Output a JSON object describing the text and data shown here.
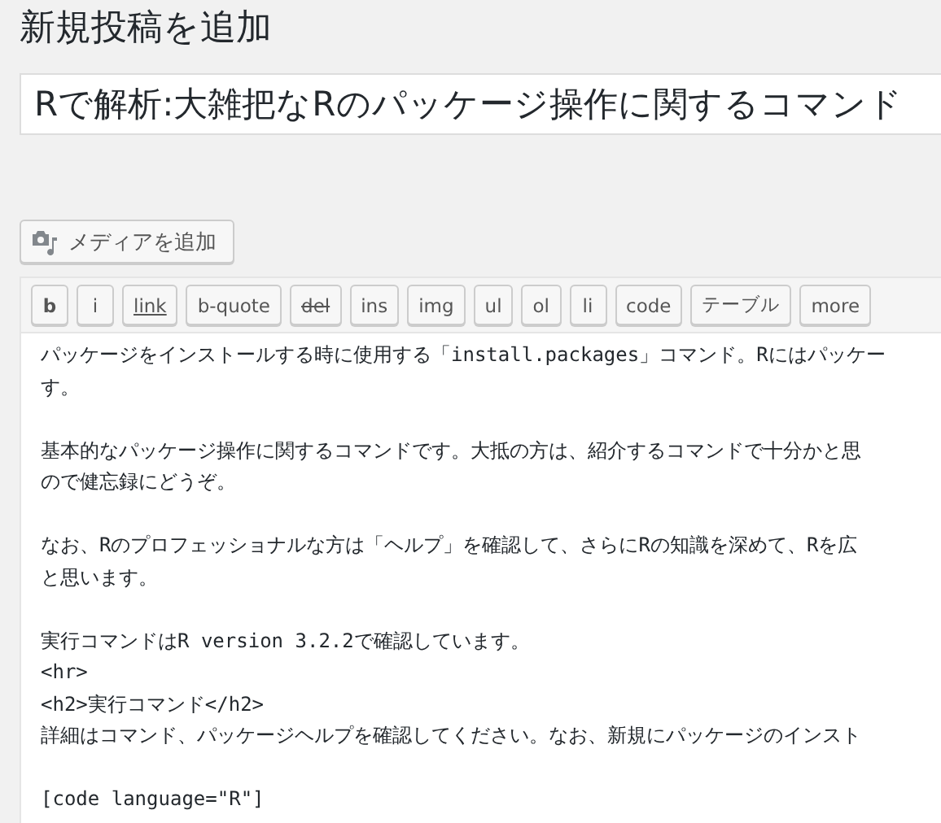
{
  "heading": "新規投稿を追加",
  "title_field": {
    "value": "Rで解析:大雑把なRのパッケージ操作に関するコマンド"
  },
  "media_button": {
    "label": "メディアを追加"
  },
  "toolbar": [
    {
      "label": "b",
      "kind": "bold"
    },
    {
      "label": "i",
      "kind": "plain"
    },
    {
      "label": "link",
      "kind": "underline"
    },
    {
      "label": "b-quote",
      "kind": "plain"
    },
    {
      "label": "del",
      "kind": "strike"
    },
    {
      "label": "ins",
      "kind": "plain"
    },
    {
      "label": "img",
      "kind": "plain"
    },
    {
      "label": "ul",
      "kind": "plain"
    },
    {
      "label": "ol",
      "kind": "plain"
    },
    {
      "label": "li",
      "kind": "plain"
    },
    {
      "label": "code",
      "kind": "plain"
    },
    {
      "label": "テーブル",
      "kind": "plain"
    },
    {
      "label": "more",
      "kind": "plain"
    }
  ],
  "editor_paragraphs": [
    [
      "パッケージをインストールする時に使用する「install.packages」コマンド。Rにはパッケー",
      "す。"
    ],
    [
      "基本的なパッケージ操作に関するコマンドです。大抵の方は、紹介するコマンドで十分かと思",
      "ので健忘録にどうぞ。"
    ],
    [
      "なお、Rのプロフェッショナルな方は「ヘルプ」を確認して、さらにRの知識を深めて、Rを広",
      "と思います。"
    ],
    [
      "実行コマンドはR version 3.2.2で確認しています。",
      "<hr>",
      "<h2>実行コマンド</h2>",
      "詳細はコマンド、パッケージヘルプを確認してください。なお、新規にパッケージのインスト"
    ],
    [
      "[code language=\"R\"]"
    ]
  ]
}
